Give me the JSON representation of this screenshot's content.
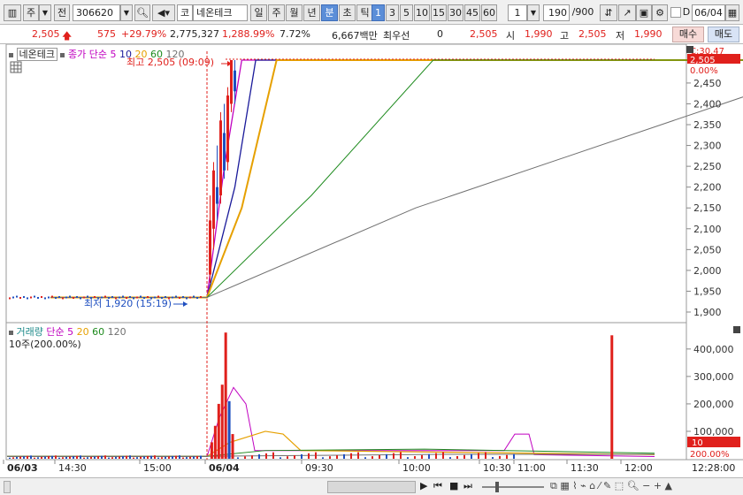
{
  "toolbar": {
    "market_label": "주",
    "jeon_label": "전",
    "stock_code": "306620",
    "kospi_prefix": "코",
    "stock_name": "네온테크",
    "period_tabs": [
      "일",
      "주",
      "월",
      "년",
      "분",
      "초",
      "틱"
    ],
    "selected_period": "분",
    "interval_tabs": [
      "1",
      "3",
      "5",
      "10",
      "15",
      "30",
      "45",
      "60"
    ],
    "selected_interval": "1",
    "multiplier": "1",
    "count_value": "190",
    "count_max": "/900",
    "date_prefix": "D",
    "date_value": "06/04"
  },
  "quote": {
    "price": "2,505",
    "change": "575",
    "change_pct": "+29.79%",
    "volume": "2,775,327",
    "volume_pct": "1,288.99%",
    "turnover": "7.72%",
    "amount": "6,667백만",
    "preferred_label": "최우선",
    "preferred_value": "0",
    "ask_price": "2,505",
    "open_label": "시",
    "open_value": "1,990",
    "high_label": "고",
    "high_value": "2,505",
    "low_label": "저",
    "low_value": "1,990",
    "buy_label": "매수",
    "sell_label": "매도"
  },
  "price_panel": {
    "stock_tag": "네온테크",
    "ma_label": "종가 단순",
    "ma_periods": [
      "5",
      "10",
      "20",
      "60",
      "120"
    ],
    "high_marker": "최고 2,505 (09:09)",
    "low_marker": "최저 1,920 (15:19)",
    "top_right": "C:30.47",
    "current_price_tag": "2,505",
    "current_pct": "0.00%",
    "y_ticks": [
      "2,450",
      "2,400",
      "2,350",
      "2,300",
      "2,250",
      "2,200",
      "2,150",
      "2,100",
      "2,050",
      "2,000",
      "1,950",
      "1,900"
    ]
  },
  "volume_panel": {
    "label": "거래량",
    "ma_label": "단순",
    "ma_periods": [
      "5",
      "20",
      "60",
      "120"
    ],
    "unit_note": "10주(200.00%)",
    "y_ticks": [
      "400,000",
      "300,000",
      "200,000",
      "100,000"
    ],
    "current_tag": "10",
    "current_pct": "200.00%"
  },
  "x_axis": {
    "labels": [
      "06/03",
      "14:30",
      "15:00",
      "06/04",
      "09:30",
      "10:00",
      "10:30",
      "11:00",
      "11:30",
      "12:00"
    ],
    "time_tag": "12:28:00"
  },
  "colors": {
    "up": "#e0201c",
    "down": "#1f4fc0",
    "ma5": "#c000c0",
    "ma10": "#1a1a9a",
    "ma20": "#e6a000",
    "ma60": "#1d8a1d",
    "ma120": "#707070"
  },
  "chart_data": [
    {
      "type": "line",
      "title": "",
      "series": [
        {
          "name": "5",
          "x": [
            "06/03 14:20",
            "06/04 09:00",
            "06/04 09:05",
            "06/04 09:10",
            "06/04 12:28"
          ],
          "values": [
            1935,
            1935,
            2250,
            2505,
            2505
          ]
        },
        {
          "name": "10",
          "x": [
            "06/03 14:20",
            "06/04 09:00",
            "06/04 09:08",
            "06/04 09:14",
            "06/04 12:28"
          ],
          "values": [
            1935,
            1935,
            2200,
            2505,
            2505
          ]
        },
        {
          "name": "20",
          "x": [
            "06/03 14:20",
            "06/04 09:00",
            "06/04 09:10",
            "06/04 09:20",
            "06/04 12:28"
          ],
          "values": [
            1935,
            1935,
            2150,
            2505,
            2505
          ]
        },
        {
          "name": "60",
          "x": [
            "06/03 14:20",
            "06/04 09:00",
            "06/04 09:30",
            "06/04 10:05",
            "06/04 12:28"
          ],
          "values": [
            1935,
            1935,
            2180,
            2505,
            2505
          ]
        },
        {
          "name": "120",
          "x": [
            "06/03 14:20",
            "06/04 09:00",
            "06/04 10:00",
            "06/04 12:00",
            "06/04 12:28"
          ],
          "values": [
            1935,
            1935,
            2150,
            2490,
            2505
          ]
        }
      ],
      "ylim": [
        1880,
        2520
      ]
    },
    {
      "type": "bar",
      "title": "",
      "categories": [
        "09:01",
        "09:02",
        "09:03",
        "09:04",
        "09:05",
        "09:06",
        "09:07",
        "10:56"
      ],
      "values": [
        60000,
        120000,
        200000,
        270000,
        460000,
        210000,
        90000,
        450000
      ],
      "ylim": [
        0,
        480000
      ]
    }
  ]
}
